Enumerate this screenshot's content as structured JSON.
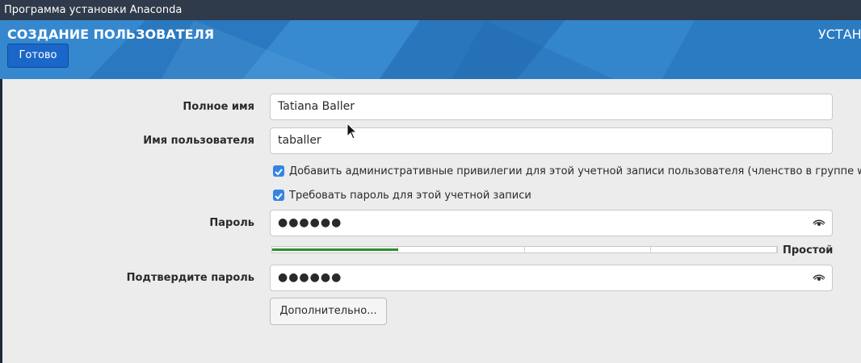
{
  "window": {
    "title": "Программа установки Anaconda"
  },
  "header": {
    "title": "СОЗДАНИЕ ПОЛЬЗОВАТЕЛЯ",
    "right_title": "УСТАН",
    "done_label": "Готово",
    "colors": {
      "header_bg": "#2d7fc6",
      "done_button_bg": "#1b67c9"
    }
  },
  "form": {
    "full_name": {
      "label": "Полное имя",
      "value": "Tatiana Baller"
    },
    "username": {
      "label": "Имя пользователя",
      "value": "taballer"
    },
    "admin_checkbox": {
      "label": "Добавить административные привилегии для этой учетной записи пользователя (членство в группе wheel)",
      "checked": true
    },
    "require_password_checkbox": {
      "label": "Требовать пароль для этой учетной записи",
      "checked": true
    },
    "password": {
      "label": "Пароль",
      "value": "●●●●●●",
      "icon": "eye-icon"
    },
    "strength": {
      "level": 0.25,
      "label": "Простой",
      "color": "#2e8b2e"
    },
    "confirm_password": {
      "label": "Подтвердите пароль",
      "value": "●●●●●●",
      "icon": "eye-icon"
    },
    "advanced_label": "Дополнительно..."
  }
}
